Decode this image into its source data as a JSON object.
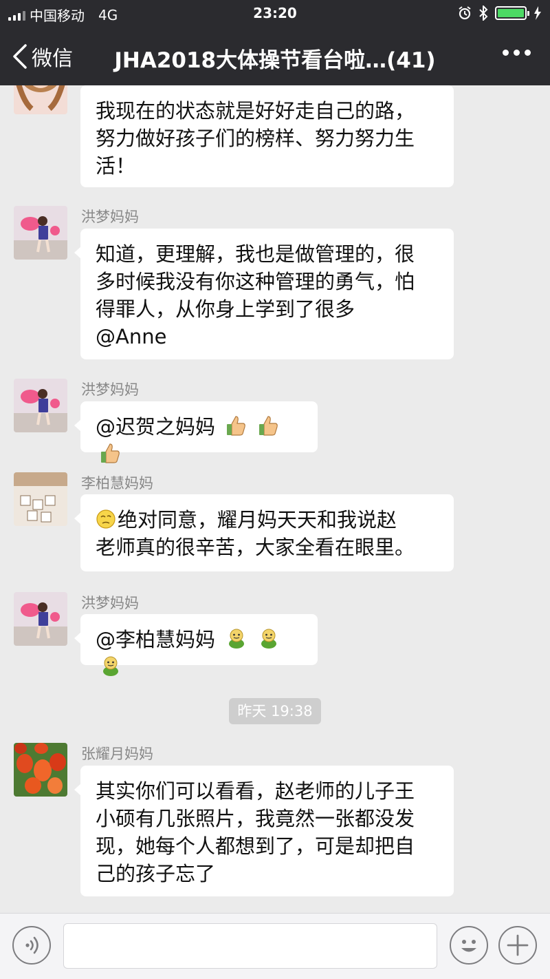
{
  "status_bar": {
    "carrier": "中国移动",
    "network": "4G",
    "time": "23:20"
  },
  "nav": {
    "back_label": "微信",
    "title": "JHA2018大体操节看台啦…(41)"
  },
  "messages": [
    {
      "sender": "",
      "text": "我现在的状态就是好好走自己的路，努力做好孩子们的榜样、努力努力生活！",
      "lines": [
        "我现在的状态就是好好走自己的路，",
        "努力做好孩子们的榜样、努力努力生",
        "活！"
      ]
    },
    {
      "sender": "洪梦妈妈",
      "lines": [
        "知道，更理解，我也是做管理的，很",
        "多时候我没有你这种管理的勇气，怕",
        "得罪人，从你身上学到了很多",
        "@Anne"
      ]
    },
    {
      "sender": "洪梦妈妈",
      "lines": [
        "@迟贺之妈妈"
      ],
      "emojis": [
        "thumbs-up",
        "thumbs-up",
        "thumbs-up"
      ]
    },
    {
      "sender": "李柏慧妈妈",
      "lines": [
        "绝对同意，耀月妈天天和我说赵",
        "老师真的很辛苦，大家全看在眼里。"
      ],
      "lead_emoji": "thinking-face"
    },
    {
      "sender": "洪梦妈妈",
      "lines": [
        "@李柏慧妈妈"
      ],
      "emojis": [
        "green-character",
        "green-character",
        "green-character"
      ]
    },
    {
      "timestamp": "昨天 19:38"
    },
    {
      "sender": "张耀月妈妈",
      "lines": [
        "其实你们可以看看，赵老师的儿子王",
        "小硕有几张照片，我竟然一张都没发",
        "现，她每个人都想到了，可是却把自",
        "己的孩子忘了"
      ]
    }
  ],
  "input_bar": {
    "icons": [
      "voice-icon",
      "emoji-face-icon",
      "plus-icon"
    ]
  },
  "colors": {
    "nav_bg": "#2b2b2f",
    "chat_bg": "#ebebeb",
    "bubble_bg": "#ffffff",
    "battery": "#4cd964"
  }
}
